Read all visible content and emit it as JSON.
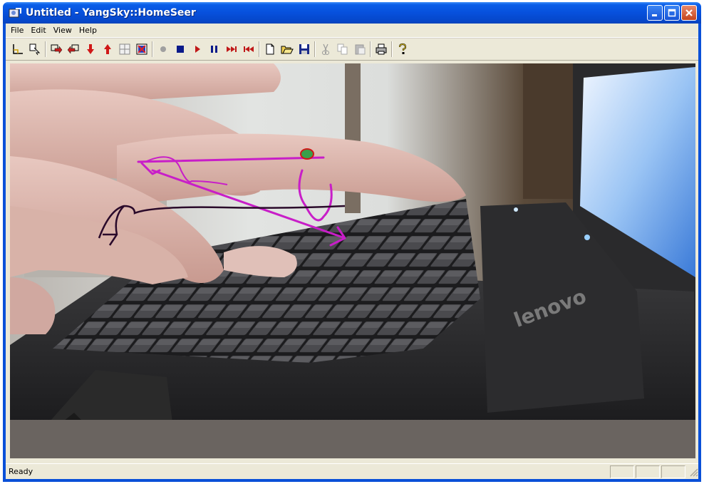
{
  "window": {
    "title": "Untitled - YangSky::HomeSeer"
  },
  "menu": {
    "items": [
      "File",
      "Edit",
      "View",
      "Help"
    ]
  },
  "toolbar": {
    "buttons": [
      {
        "name": "axis-icon"
      },
      {
        "name": "copy-pointer-icon"
      },
      {
        "name": "forward-arrow-icon"
      },
      {
        "name": "back-arrow-icon"
      },
      {
        "name": "down-arrow-icon"
      },
      {
        "name": "up-arrow-icon"
      },
      {
        "name": "grid-icon"
      },
      {
        "name": "target-grid-icon"
      },
      {
        "name": "record-icon"
      },
      {
        "name": "stop-icon"
      },
      {
        "name": "play-icon"
      },
      {
        "name": "pause-icon"
      },
      {
        "name": "fast-forward-icon"
      },
      {
        "name": "rewind-icon"
      },
      {
        "name": "new-file-icon"
      },
      {
        "name": "open-folder-icon"
      },
      {
        "name": "save-icon"
      },
      {
        "name": "cut-icon"
      },
      {
        "name": "copy-icon"
      },
      {
        "name": "paste-icon"
      },
      {
        "name": "print-icon"
      },
      {
        "name": "help-icon"
      }
    ]
  },
  "status": {
    "text": "Ready"
  },
  "colors": {
    "trace_magenta": "#c81ec8",
    "trace_dark": "#2a0a2a",
    "marker_green": "#3aa04a",
    "marker_red": "#d01818"
  }
}
